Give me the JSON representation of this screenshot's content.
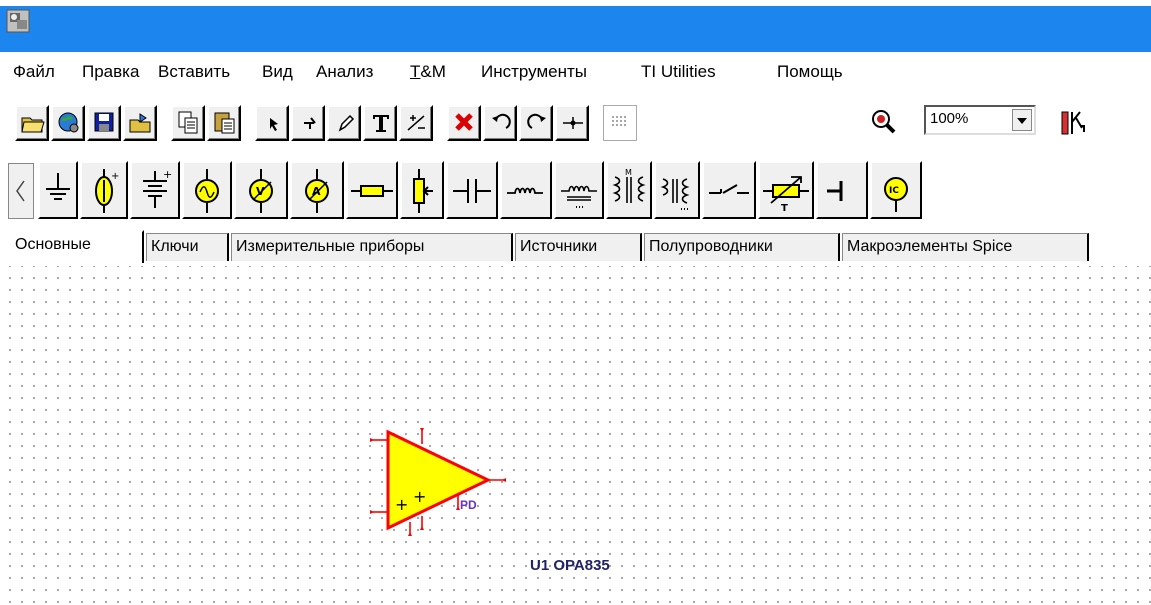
{
  "menu": {
    "items": [
      {
        "label": "Файл",
        "name": "menu-file"
      },
      {
        "label": "Правка",
        "name": "menu-edit"
      },
      {
        "label": "Вставить",
        "name": "menu-insert"
      },
      {
        "label": "Вид",
        "name": "menu-view"
      },
      {
        "label": "Анализ",
        "name": "menu-analysis"
      },
      {
        "label": "T&M",
        "name": "menu-tm"
      },
      {
        "label": "Инструменты",
        "name": "menu-tools"
      },
      {
        "label": "TI Utilities",
        "name": "menu-ti-utilities"
      },
      {
        "label": "Помощь",
        "name": "menu-help"
      }
    ]
  },
  "toolbar": {
    "zoom_value": "100%"
  },
  "tabs": [
    {
      "label": "Основные",
      "active": true
    },
    {
      "label": "Ключи",
      "active": false
    },
    {
      "label": "Измерительные приборы",
      "active": false
    },
    {
      "label": "Источники",
      "active": false
    },
    {
      "label": "Полупроводники",
      "active": false
    },
    {
      "label": "Макроэлементы Spice",
      "active": false
    }
  ],
  "canvas": {
    "component": {
      "pin_label": "PD",
      "ref_label": "U1 OPA835",
      "fill_color": "#ffff00",
      "stroke_color": "#ff0000"
    }
  },
  "colors": {
    "titlebar": "#1c86ee"
  }
}
